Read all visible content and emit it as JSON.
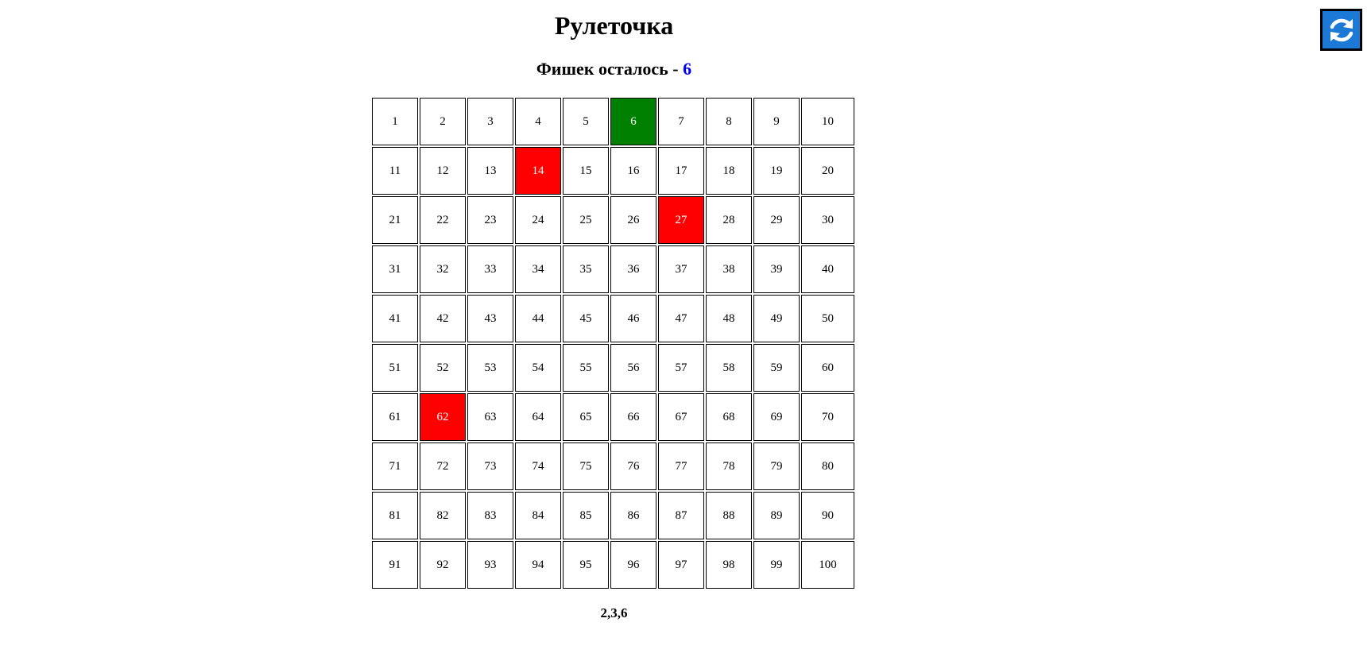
{
  "title": "Рулеточка",
  "chips": {
    "label": "Фишек осталось - ",
    "count": "6"
  },
  "reload_icon": "refresh-icon",
  "colors": {
    "green": "#008000",
    "red": "#ff0000",
    "count": "#0000ff",
    "button": "#1c7ad6"
  },
  "grid": {
    "numbers": [
      1,
      2,
      3,
      4,
      5,
      6,
      7,
      8,
      9,
      10,
      11,
      12,
      13,
      14,
      15,
      16,
      17,
      18,
      19,
      20,
      21,
      22,
      23,
      24,
      25,
      26,
      27,
      28,
      29,
      30,
      31,
      32,
      33,
      34,
      35,
      36,
      37,
      38,
      39,
      40,
      41,
      42,
      43,
      44,
      45,
      46,
      47,
      48,
      49,
      50,
      51,
      52,
      53,
      54,
      55,
      56,
      57,
      58,
      59,
      60,
      61,
      62,
      63,
      64,
      65,
      66,
      67,
      68,
      69,
      70,
      71,
      72,
      73,
      74,
      75,
      76,
      77,
      78,
      79,
      80,
      81,
      82,
      83,
      84,
      85,
      86,
      87,
      88,
      89,
      90,
      91,
      92,
      93,
      94,
      95,
      96,
      97,
      98,
      99,
      100
    ],
    "green": [
      6
    ],
    "red": [
      14,
      27,
      62
    ]
  },
  "result": "2,3,6"
}
